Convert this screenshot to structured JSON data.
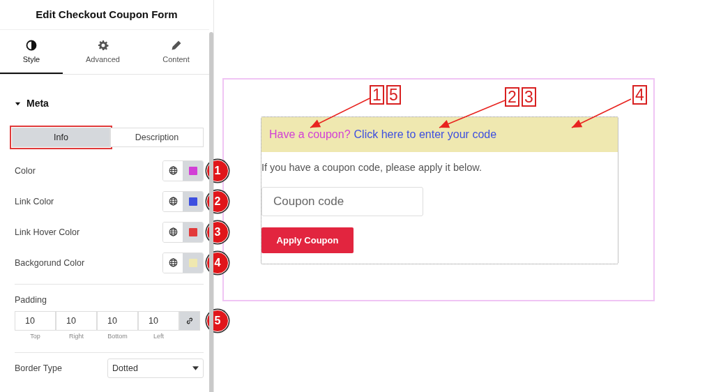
{
  "panel": {
    "title": "Edit Checkout Coupon Form",
    "tabs": [
      {
        "label": "Style",
        "selected": true
      },
      {
        "label": "Advanced",
        "selected": false
      },
      {
        "label": "Content",
        "selected": false
      }
    ],
    "section": {
      "title": "Meta",
      "expanded": true
    },
    "subtabs": [
      {
        "label": "Info",
        "selected": true,
        "highlighted": true
      },
      {
        "label": "Description",
        "selected": false,
        "highlighted": false
      }
    ],
    "color_rows": [
      {
        "label": "Color",
        "color": "#d23fd6",
        "badge": "1"
      },
      {
        "label": "Link Color",
        "color": "#3d4fe0",
        "badge": "2"
      },
      {
        "label": "Link Hover Color",
        "color": "#e23a3a",
        "badge": "3"
      },
      {
        "label": "Backgorund Color",
        "color": "#efe8b0",
        "badge": "4"
      }
    ],
    "padding": {
      "label": "Padding",
      "fields": [
        {
          "value": "10",
          "caption": "Top"
        },
        {
          "value": "10",
          "caption": "Right"
        },
        {
          "value": "10",
          "caption": "Bottom"
        },
        {
          "value": "10",
          "caption": "Left"
        }
      ],
      "linked": true,
      "badge": "5"
    },
    "border_type": {
      "label": "Border Type",
      "value": "Dotted"
    }
  },
  "preview": {
    "notice_text": "Have a coupon?",
    "notice_link": "Click here to enter your code",
    "description": "If you have a coupon code, please apply it below.",
    "coupon_field": {
      "placeholder": "Coupon code"
    },
    "apply_button": "Apply Coupon"
  },
  "callouts": [
    {
      "labels": [
        "1",
        "5"
      ]
    },
    {
      "labels": [
        "2",
        "3"
      ]
    },
    {
      "labels": [
        "4"
      ]
    }
  ]
}
